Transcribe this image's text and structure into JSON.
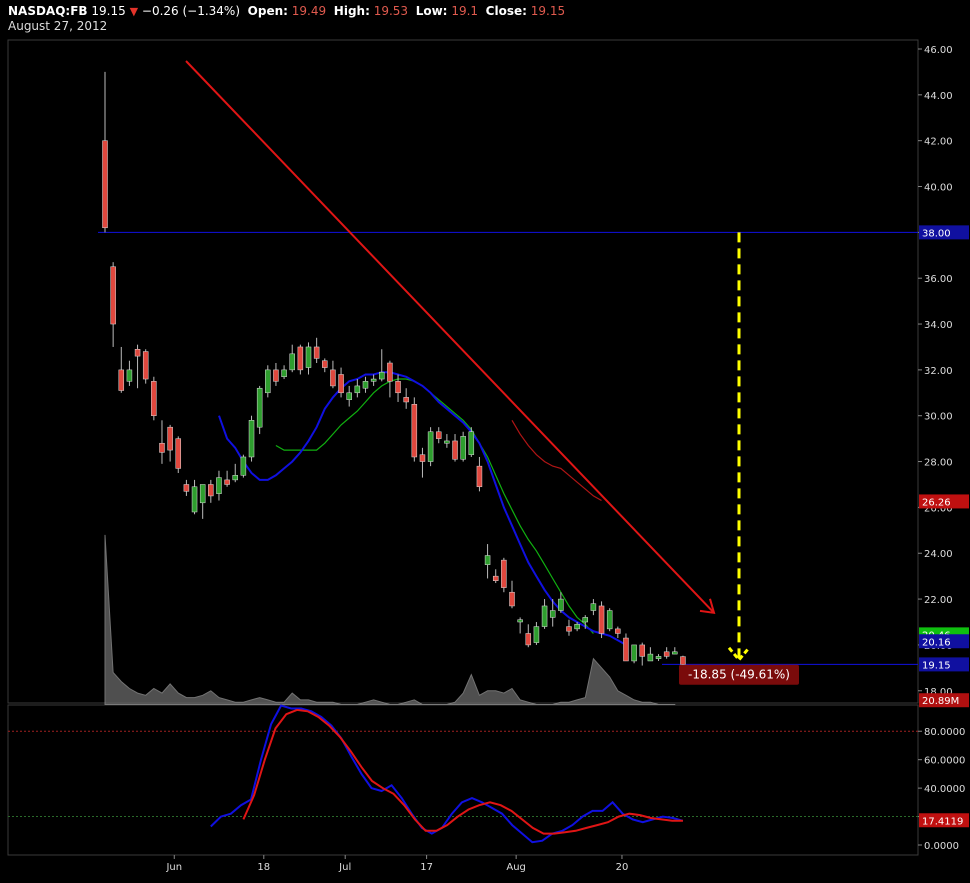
{
  "header": {
    "symbol": "NASDAQ:FB",
    "price": "19.15",
    "change": "−0.26 (−1.34%)",
    "open_label": "Open:",
    "open": "19.49",
    "high_label": "High:",
    "high": "19.53",
    "low_label": "Low:",
    "low": "19.1",
    "close_label": "Close:",
    "close": "19.15",
    "date": "August 27, 2012"
  },
  "colors": {
    "up": "#2e9e2e",
    "down": "#e0483e",
    "blue_line": "#1010e0",
    "green_line": "#10b010",
    "red_line": "#b01515",
    "trend": "#e01515",
    "target": "#ffff00",
    "volume": "#6a6a6a",
    "grid": "#3a3a3a"
  },
  "chart_data": [
    {
      "type": "candlestick",
      "title": "",
      "x_ticks": [
        "Jun",
        "18",
        "Jul",
        "17",
        "Aug",
        "20"
      ],
      "y_ticks": [
        "46.00",
        "44.00",
        "42.00",
        "40.00",
        "38.00",
        "36.00",
        "34.00",
        "32.00",
        "30.00",
        "28.00",
        "26.00",
        "24.00",
        "22.00",
        "20.00",
        "18.00"
      ],
      "ylim": [
        17.5,
        46.6
      ],
      "candles": [
        [
          42.0,
          45.0,
          38.0,
          38.2
        ],
        [
          36.5,
          36.7,
          33.0,
          34.0
        ],
        [
          32.0,
          33.0,
          31.0,
          31.1
        ],
        [
          31.5,
          32.4,
          31.3,
          32.0
        ],
        [
          32.9,
          33.1,
          31.2,
          32.6
        ],
        [
          32.8,
          32.9,
          31.4,
          31.6
        ],
        [
          31.5,
          31.7,
          29.8,
          30.0
        ],
        [
          28.8,
          29.8,
          27.9,
          28.4
        ],
        [
          29.5,
          29.6,
          28.0,
          28.5
        ],
        [
          29.0,
          29.1,
          27.5,
          27.7
        ],
        [
          27.0,
          27.2,
          26.5,
          26.7
        ],
        [
          25.8,
          27.2,
          25.7,
          26.9
        ],
        [
          26.2,
          27.0,
          25.5,
          27.0
        ],
        [
          27.0,
          27.2,
          26.2,
          26.5
        ],
        [
          26.6,
          27.6,
          26.3,
          27.3
        ],
        [
          27.2,
          27.6,
          26.9,
          27.0
        ],
        [
          27.2,
          27.9,
          27.1,
          27.4
        ],
        [
          27.4,
          28.3,
          27.3,
          28.2
        ],
        [
          28.2,
          30.0,
          28.0,
          29.8
        ],
        [
          29.5,
          31.3,
          29.2,
          31.2
        ],
        [
          31.0,
          32.2,
          30.8,
          32.0
        ],
        [
          32.0,
          32.3,
          31.3,
          31.5
        ],
        [
          31.7,
          32.2,
          31.6,
          32.0
        ],
        [
          32.0,
          33.1,
          31.9,
          32.7
        ],
        [
          33.0,
          33.1,
          31.8,
          32.0
        ],
        [
          32.1,
          33.2,
          31.8,
          33.0
        ],
        [
          33.0,
          33.4,
          32.3,
          32.5
        ],
        [
          32.4,
          32.5,
          31.9,
          32.1
        ],
        [
          32.0,
          32.4,
          31.2,
          31.3
        ],
        [
          31.8,
          32.1,
          30.8,
          31.0
        ],
        [
          30.7,
          31.3,
          30.4,
          31.0
        ],
        [
          31.0,
          31.6,
          30.8,
          31.3
        ],
        [
          31.2,
          31.7,
          31.0,
          31.5
        ],
        [
          31.5,
          31.8,
          31.3,
          31.6
        ],
        [
          31.6,
          32.9,
          31.5,
          31.9
        ],
        [
          32.3,
          32.4,
          30.8,
          31.5
        ],
        [
          31.5,
          31.8,
          30.6,
          31.0
        ],
        [
          30.8,
          31.2,
          30.3,
          30.6
        ],
        [
          30.5,
          30.8,
          28.0,
          28.2
        ],
        [
          28.3,
          28.6,
          27.3,
          28.0
        ],
        [
          28.0,
          29.5,
          27.8,
          29.3
        ],
        [
          29.3,
          29.5,
          28.8,
          29.0
        ],
        [
          28.8,
          29.2,
          28.6,
          28.9
        ],
        [
          28.9,
          29.2,
          28.0,
          28.1
        ],
        [
          28.1,
          29.3,
          28.0,
          29.1
        ],
        [
          28.3,
          29.5,
          28.2,
          29.3
        ],
        [
          27.8,
          28.2,
          26.7,
          26.9
        ],
        [
          23.5,
          24.4,
          22.9,
          23.9
        ],
        [
          23.0,
          23.3,
          22.7,
          22.8
        ],
        [
          23.7,
          23.8,
          22.3,
          22.5
        ],
        [
          22.3,
          22.8,
          21.6,
          21.7
        ],
        [
          21.0,
          21.2,
          20.5,
          21.1
        ],
        [
          20.5,
          20.9,
          19.9,
          20.0
        ],
        [
          20.1,
          21.0,
          20.0,
          20.8
        ],
        [
          20.8,
          22.0,
          20.7,
          21.7
        ],
        [
          21.2,
          22.0,
          20.8,
          21.5
        ],
        [
          21.5,
          22.3,
          21.4,
          22.0
        ],
        [
          20.8,
          21.1,
          20.4,
          20.6
        ],
        [
          20.7,
          21.0,
          20.6,
          20.9
        ],
        [
          21.0,
          21.3,
          20.7,
          21.2
        ],
        [
          21.5,
          22.0,
          21.3,
          21.8
        ],
        [
          21.7,
          21.9,
          20.3,
          20.5
        ],
        [
          20.7,
          21.6,
          20.6,
          21.5
        ],
        [
          20.7,
          20.8,
          20.3,
          20.5
        ],
        [
          20.3,
          20.5,
          19.3,
          19.3
        ],
        [
          19.3,
          20.0,
          19.2,
          20.0
        ],
        [
          20.0,
          20.1,
          19.1,
          19.5
        ],
        [
          19.3,
          19.9,
          19.3,
          19.6
        ],
        [
          19.4,
          19.6,
          19.3,
          19.5
        ],
        [
          19.7,
          19.9,
          19.4,
          19.5
        ],
        [
          19.6,
          19.9,
          19.6,
          19.7
        ],
        [
          19.49,
          19.53,
          19.1,
          19.15
        ]
      ],
      "ma_blue": [
        [
          null,
          0
        ],
        [
          null,
          0
        ],
        [
          null,
          0
        ],
        [
          null,
          0
        ],
        [
          null,
          0
        ],
        [
          null,
          0
        ],
        [
          null,
          0
        ],
        [
          null,
          0
        ],
        [
          null,
          0
        ],
        [
          null,
          0
        ],
        [
          null,
          0
        ],
        [
          null,
          0
        ],
        [
          null,
          0
        ],
        [
          30.0,
          13
        ],
        [
          29.0,
          14
        ],
        [
          28.6,
          15
        ],
        [
          28.0,
          16
        ],
        [
          27.5,
          17
        ],
        [
          27.2,
          18
        ],
        [
          27.2,
          19
        ],
        [
          27.4,
          20
        ],
        [
          27.7,
          21
        ],
        [
          28.0,
          22
        ],
        [
          28.4,
          23
        ],
        [
          28.9,
          24
        ],
        [
          29.5,
          25
        ],
        [
          30.3,
          26
        ],
        [
          30.8,
          27
        ],
        [
          31.2,
          28
        ],
        [
          31.5,
          29
        ],
        [
          31.6,
          30
        ],
        [
          31.8,
          31
        ],
        [
          31.8,
          32
        ],
        [
          31.9,
          33
        ],
        [
          31.9,
          34
        ],
        [
          31.8,
          35
        ],
        [
          31.7,
          36
        ],
        [
          31.5,
          37
        ],
        [
          31.3,
          38
        ],
        [
          31.0,
          39
        ],
        [
          30.6,
          40
        ],
        [
          30.3,
          41
        ],
        [
          30.0,
          42
        ],
        [
          29.7,
          43
        ],
        [
          29.3,
          44
        ],
        [
          28.8,
          45
        ],
        [
          28.0,
          46
        ],
        [
          27.0,
          47
        ],
        [
          26.0,
          48
        ],
        [
          25.2,
          49
        ],
        [
          24.4,
          50
        ],
        [
          23.6,
          51
        ],
        [
          23.0,
          52
        ],
        [
          22.4,
          53
        ],
        [
          21.9,
          54
        ],
        [
          21.5,
          55
        ],
        [
          21.2,
          56
        ],
        [
          21.0,
          57
        ],
        [
          20.8,
          58
        ],
        [
          20.6,
          59
        ],
        [
          20.5,
          60
        ],
        [
          20.4,
          61
        ],
        [
          20.2,
          62
        ],
        [
          20.0,
          63
        ]
      ],
      "ma_green": [
        [
          28.7,
          20
        ],
        [
          28.5,
          21
        ],
        [
          28.5,
          22
        ],
        [
          28.5,
          23
        ],
        [
          28.5,
          24
        ],
        [
          28.5,
          25
        ],
        [
          28.8,
          26
        ],
        [
          29.2,
          27
        ],
        [
          29.6,
          28
        ],
        [
          29.9,
          29
        ],
        [
          30.2,
          30
        ],
        [
          30.6,
          31
        ],
        [
          31.0,
          32
        ],
        [
          31.3,
          33
        ],
        [
          31.5,
          34
        ],
        [
          31.6,
          35
        ],
        [
          31.6,
          36
        ],
        [
          31.5,
          37
        ],
        [
          31.3,
          38
        ],
        [
          31.0,
          39
        ],
        [
          30.7,
          40
        ],
        [
          30.4,
          41
        ],
        [
          30.1,
          42
        ],
        [
          29.8,
          43
        ],
        [
          29.4,
          44
        ],
        [
          28.8,
          45
        ],
        [
          28.2,
          46
        ],
        [
          27.4,
          47
        ],
        [
          26.6,
          48
        ],
        [
          25.9,
          49
        ],
        [
          25.2,
          50
        ],
        [
          24.6,
          51
        ],
        [
          24.1,
          52
        ],
        [
          23.5,
          53
        ],
        [
          22.9,
          54
        ],
        [
          22.3,
          55
        ],
        [
          21.7,
          56
        ],
        [
          21.2,
          57
        ],
        [
          20.9,
          58
        ],
        [
          20.5,
          59
        ]
      ],
      "ma_red": [
        [
          29.8,
          0
        ],
        [
          29.2,
          1
        ],
        [
          28.7,
          2
        ],
        [
          28.3,
          3
        ],
        [
          28.0,
          4
        ],
        [
          27.8,
          5
        ],
        [
          27.7,
          6
        ],
        [
          27.4,
          7
        ],
        [
          27.1,
          8
        ],
        [
          26.8,
          9
        ],
        [
          26.5,
          10
        ],
        [
          26.3,
          11
        ]
      ],
      "volume_series": [
        24.8,
        18.8,
        18.4,
        18.1,
        17.9,
        17.8,
        18.1,
        17.9,
        18.3,
        17.9,
        17.7,
        17.7,
        17.8,
        18.0,
        17.7,
        17.6,
        17.5,
        17.5,
        17.6,
        17.7,
        17.6,
        17.5,
        17.5,
        17.9,
        17.6,
        17.6,
        17.5,
        17.5,
        17.5,
        17.4,
        17.4,
        17.4,
        17.5,
        17.6,
        17.5,
        17.4,
        17.4,
        17.5,
        17.6,
        17.4,
        17.4,
        17.4,
        17.4,
        17.5,
        17.9,
        18.7,
        17.8,
        18.0,
        18.0,
        17.9,
        18.1,
        17.6,
        17.5,
        17.4,
        17.4,
        17.4,
        17.5,
        17.5,
        17.6,
        17.7,
        19.4,
        19.0,
        18.6,
        18.0,
        17.8,
        17.6,
        17.5,
        17.5,
        17.4,
        17.4,
        17.4
      ],
      "levels": {
        "resistance": 38.0,
        "last": 19.15
      },
      "trendline": [
        [
          46.0,
          0
        ],
        [
          21.4,
          1
        ]
      ],
      "target_arrow": {
        "top": 38.0,
        "bottom": 19.35
      },
      "tags": {
        "resistance": "38.00",
        "red_ma": "26.26",
        "green_ma": "20.46",
        "blue_ma": "20.16",
        "last": "19.15",
        "volume": "20.89M",
        "change_box": "-18.85 (-49.61%)"
      }
    },
    {
      "type": "line",
      "title": "",
      "y_ticks": [
        "80.0000",
        "60.0000",
        "40.0000",
        "20.0000",
        "0.0000"
      ],
      "ylim": [
        -3,
        100
      ],
      "ref_lines": [
        80,
        20
      ],
      "blue": [
        13,
        20,
        22,
        28,
        32,
        60,
        85,
        98,
        96,
        96,
        94,
        90,
        84,
        75,
        62,
        50,
        40,
        38,
        42,
        33,
        22,
        12,
        8,
        12,
        22,
        30,
        33,
        30,
        26,
        22,
        14,
        8,
        2,
        3,
        8,
        10,
        14,
        20,
        24,
        24,
        30,
        22,
        18,
        16,
        18,
        20,
        19,
        17
      ],
      "red": [
        18,
        35,
        60,
        82,
        92,
        95,
        94,
        90,
        84,
        76,
        66,
        55,
        45,
        40,
        36,
        28,
        18,
        10,
        10,
        14,
        20,
        25,
        28,
        30,
        28,
        24,
        18,
        12,
        8,
        8,
        9,
        10,
        12,
        14,
        16,
        20,
        22,
        21,
        19,
        18,
        17,
        17
      ],
      "last_tag": "17.4119"
    }
  ]
}
